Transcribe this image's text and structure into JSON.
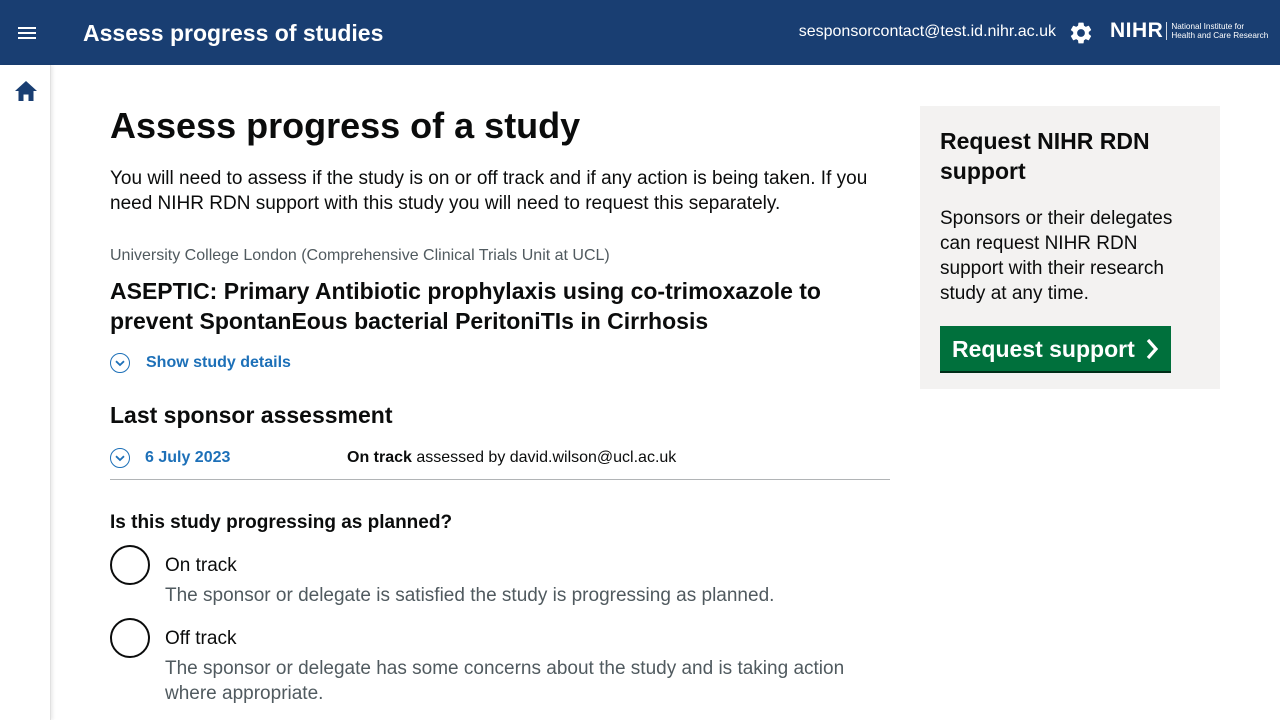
{
  "header": {
    "title": "Assess progress of studies",
    "user_email": "sesponsorcontact@test.id.nihr.ac.uk",
    "logo": {
      "mark": "NIHR",
      "text_line1": "National Institute for",
      "text_line2": "Health and Care Research"
    },
    "icons": {
      "menu": "menu-icon",
      "settings": "gear-icon"
    },
    "background": "#193e72"
  },
  "sidebar": {
    "home_icon": "home-icon"
  },
  "main": {
    "page_title": "Assess progress of a study",
    "intro": "You will need to assess if the study is on or off track and if any action is being taken. If you need NIHR RDN support with this study you will need to request this separately.",
    "organisation": "University College London (Comprehensive Clinical Trials Unit at UCL)",
    "study_title": "ASEPTIC: Primary Antibiotic prophylaxis using co-trimoxazole to prevent SpontanEous bacterial PeritoniTIs in Cirrhosis",
    "show_details_label": "Show study details",
    "last_assessment": {
      "heading": "Last sponsor assessment",
      "date": "6 July 2023",
      "status": "On track",
      "assessed_by_text": "assessed by david.wilson@ucl.ac.uk"
    },
    "question": "Is this study progressing as planned?",
    "options": [
      {
        "label": "On track",
        "hint": "The sponsor or delegate is satisfied the study is progressing as planned.",
        "selected": false
      },
      {
        "label": "Off track",
        "hint": "The sponsor or delegate has some concerns about the study and is taking action where appropriate.",
        "selected": false
      }
    ]
  },
  "aside": {
    "title": "Request NIHR RDN support",
    "body": "Sponsors or their delegates can request NIHR RDN support with their research study at any time.",
    "button_label": "Request support",
    "button_color": "#00703c"
  },
  "colors": {
    "link": "#1d70b8",
    "hint": "#505a5f",
    "panel": "#f3f2f1"
  }
}
